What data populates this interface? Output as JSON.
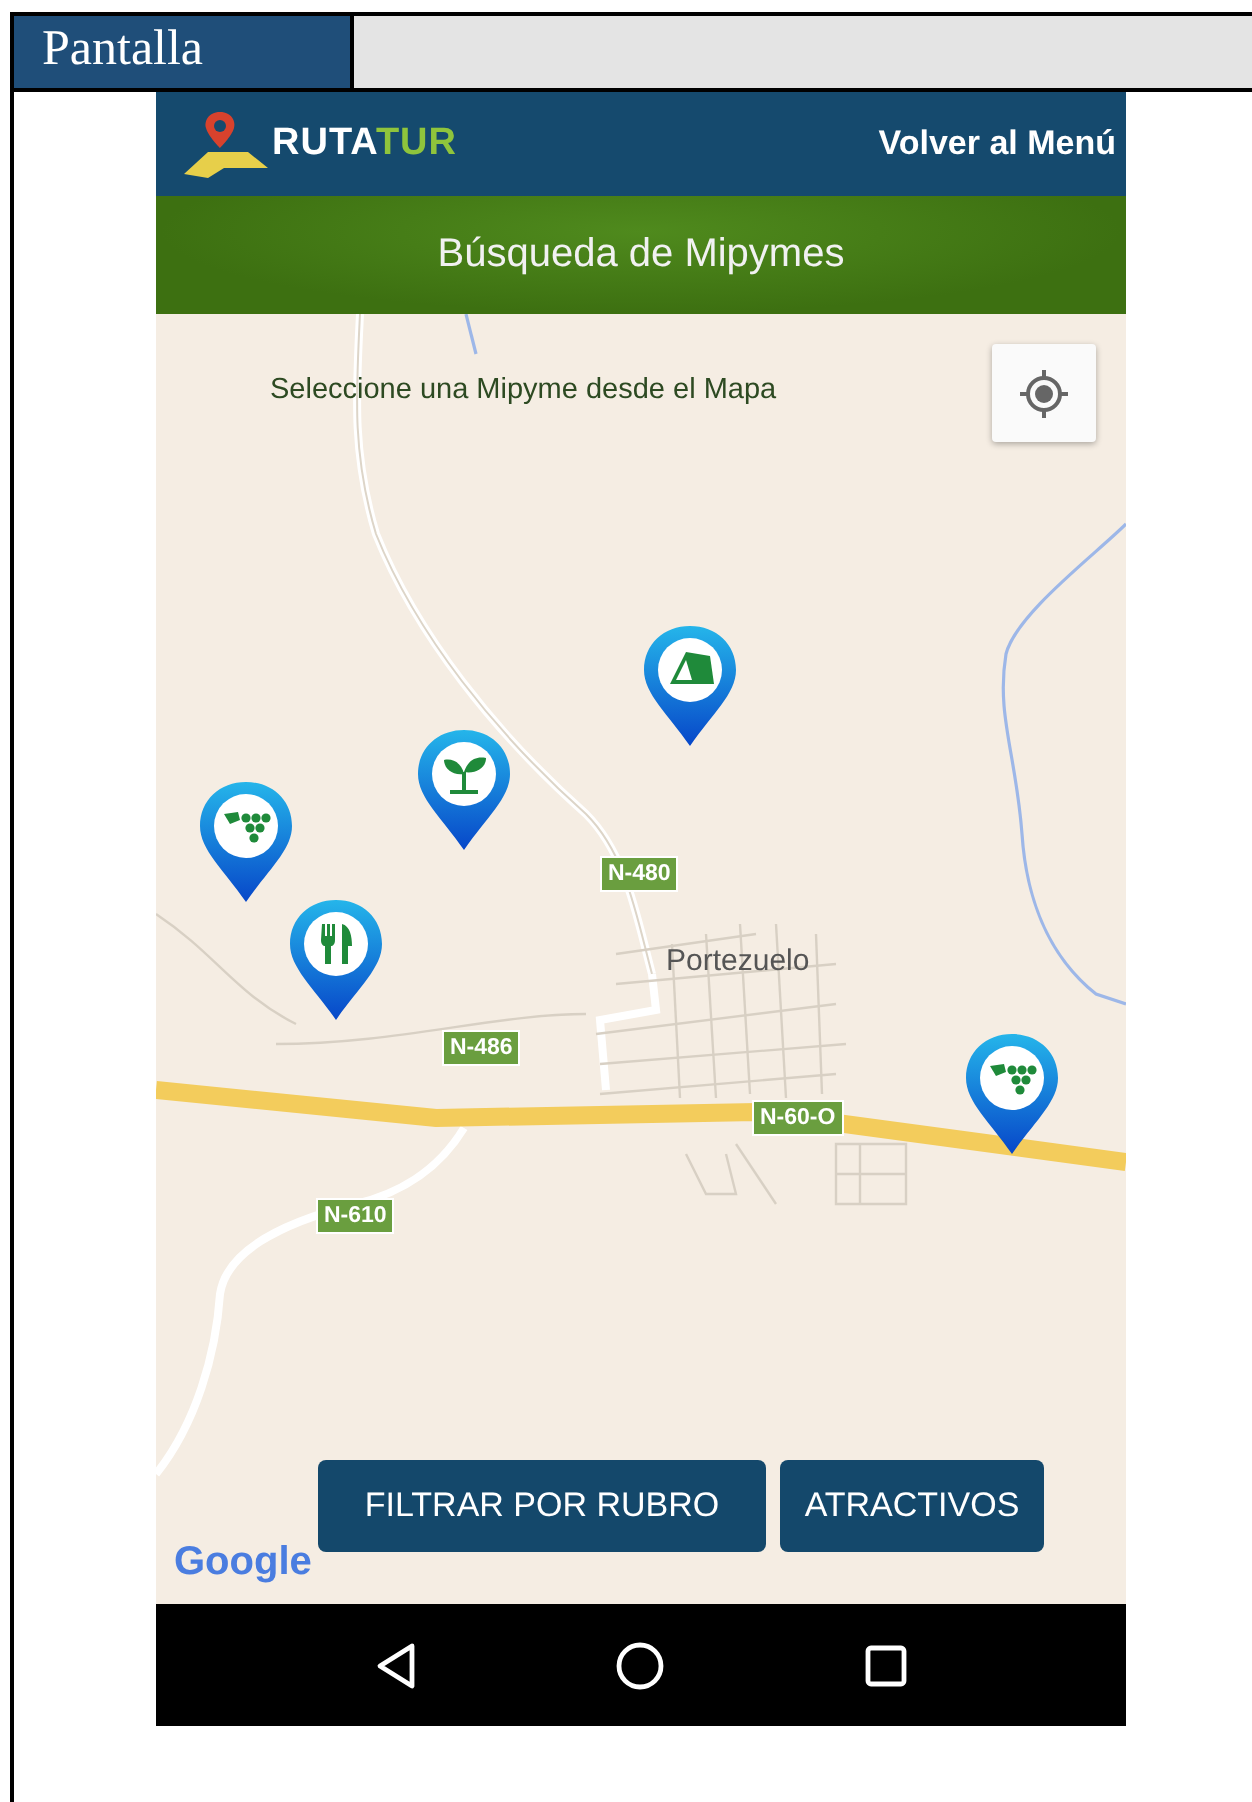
{
  "table": {
    "header": "Pantalla"
  },
  "app_bar": {
    "logo_parts": [
      "RUTA",
      "TUR"
    ],
    "menu_link": "Volver al Menú"
  },
  "title_bar": {
    "title": "Búsqueda de Mipymes"
  },
  "map": {
    "instruction": "Seleccione una Mipyme desde el Mapa",
    "town": "Portezuelo",
    "road_labels": [
      "N-480",
      "N-486",
      "N-60-O",
      "N-610"
    ],
    "pins": [
      {
        "kind": "tent"
      },
      {
        "kind": "sprout"
      },
      {
        "kind": "grapes"
      },
      {
        "kind": "cutlery"
      },
      {
        "kind": "grapes"
      }
    ],
    "attribution": "Google"
  },
  "buttons": [
    "FILTRAR POR RUBRO",
    "ATRACTIVOS"
  ],
  "nav_bar": [
    {
      "kind": "back"
    },
    {
      "kind": "home"
    },
    {
      "kind": "recents"
    }
  ]
}
